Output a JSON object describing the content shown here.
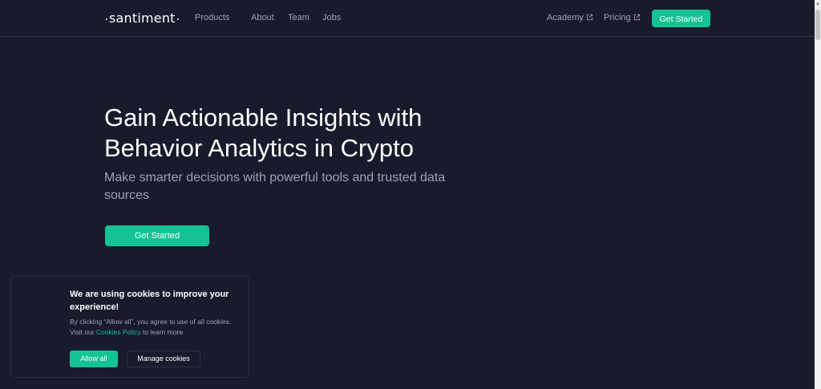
{
  "header": {
    "logo_text": "santiment",
    "nav": {
      "products": "Products",
      "about": "About",
      "team": "Team",
      "jobs": "Jobs",
      "academy": "Academy",
      "pricing": "Pricing"
    },
    "cta_label": "Get Started"
  },
  "hero": {
    "title": "Gain Actionable Insights with Behavior Analytics in Crypto",
    "subtitle": "Make smarter decisions with powerful tools and trusted data sources",
    "cta_label": "Get Started"
  },
  "cookie_banner": {
    "title": "We are using cookies to improve your experience!",
    "text_before_link": "By clicking “Allow all”, you agree to use of all cookies. Visit our ",
    "link_text": "Cookies Policy",
    "text_after_link": " to learn more.",
    "allow_label": "Allow all",
    "manage_label": "Manage cookies"
  },
  "colors": {
    "background": "#181b2b",
    "accent": "#14c393",
    "muted_text": "#9ea2b8"
  },
  "icons": {
    "external_link": "external-link-icon",
    "scroll_up": "arrow-up-icon"
  }
}
